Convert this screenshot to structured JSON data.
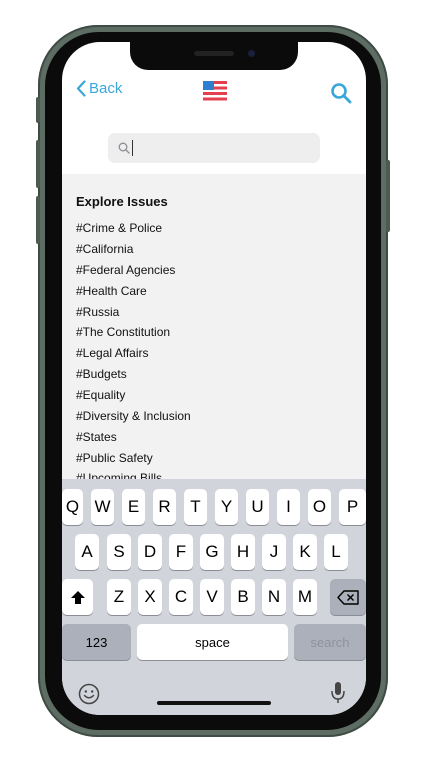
{
  "nav": {
    "back_label": "Back",
    "flag_icon": "us-flag-icon",
    "search_icon": "search-icon"
  },
  "search": {
    "value": "",
    "placeholder": ""
  },
  "explore": {
    "title": "Explore Issues",
    "issues": [
      "#Crime & Police",
      "#California",
      "#Federal Agencies",
      "#Health Care",
      "#Russia",
      "#The Constitution",
      "#Legal Affairs",
      "#Budgets",
      "#Equality",
      "#Diversity & Inclusion",
      "#States",
      "#Public Safety",
      "#Upcoming Bills"
    ]
  },
  "keyboard": {
    "row1": [
      "Q",
      "W",
      "E",
      "R",
      "T",
      "Y",
      "U",
      "I",
      "O",
      "P"
    ],
    "row2": [
      "A",
      "S",
      "D",
      "F",
      "G",
      "H",
      "J",
      "K",
      "L"
    ],
    "row3": [
      "Z",
      "X",
      "C",
      "V",
      "B",
      "N",
      "M"
    ],
    "numbers_label": "123",
    "space_label": "space",
    "search_label": "search"
  },
  "colors": {
    "accent": "#3aa6d9",
    "flag_red": "#e4414f",
    "flag_blue": "#2f7fd0",
    "phone_frame": "#5d6d63"
  }
}
